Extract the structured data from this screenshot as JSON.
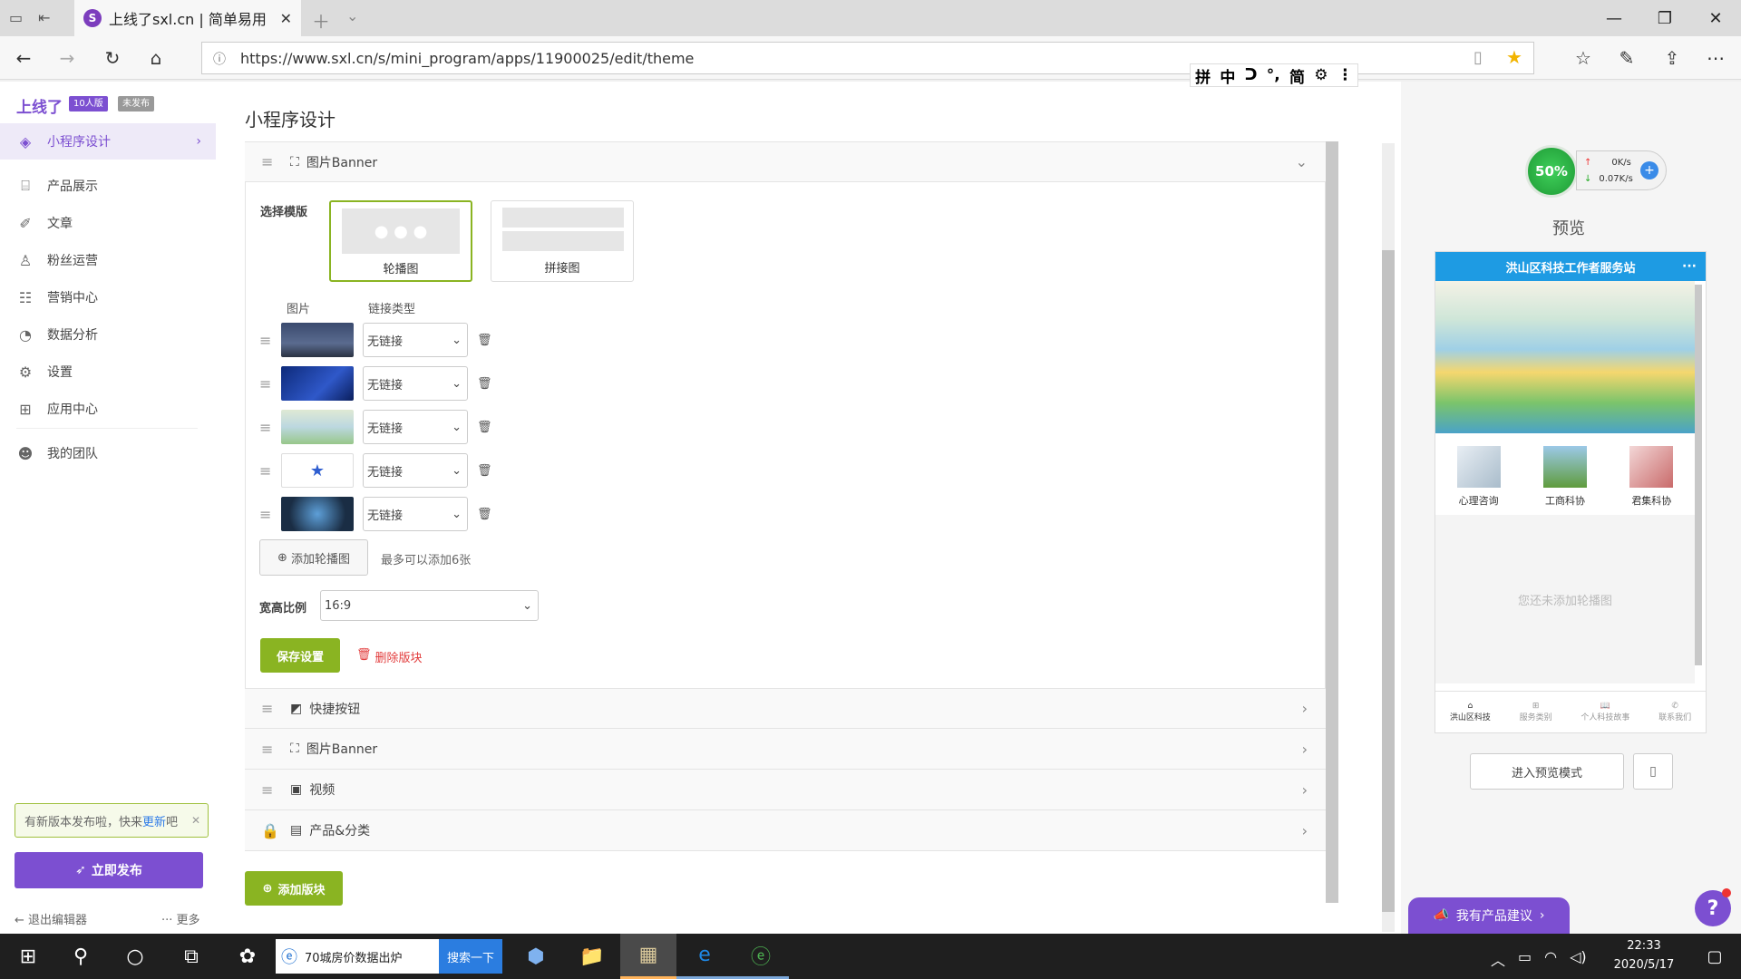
{
  "browser": {
    "tab_title": "上线了sxl.cn | 简单易用",
    "url": "https://www.sxl.cn/s/mini_program/apps/11900025/edit/theme",
    "ime": [
      "拼",
      "中",
      "ᑐ",
      "°,",
      "简",
      "⚙",
      "⋮"
    ]
  },
  "sidebar": {
    "logo": "上线了",
    "badge_plan": "10人版",
    "badge_status": "未发布",
    "items": [
      {
        "label": "小程序设计",
        "icon": "layers-icon"
      },
      {
        "label": "产品展示",
        "icon": "shop-icon"
      },
      {
        "label": "文章",
        "icon": "pen-icon"
      },
      {
        "label": "粉丝运营",
        "icon": "users-icon"
      },
      {
        "label": "营销中心",
        "icon": "ticket-icon"
      },
      {
        "label": "数据分析",
        "icon": "pie-icon"
      },
      {
        "label": "设置",
        "icon": "gear-icon"
      },
      {
        "label": "应用中心",
        "icon": "apps-icon"
      },
      {
        "label": "我的团队",
        "icon": "team-icon"
      }
    ],
    "update_text": "有新版本发布啦，快来",
    "update_link": "更新",
    "update_suffix": "吧",
    "publish_btn": "立即发布",
    "exit": "退出编辑器",
    "more": "··· 更多"
  },
  "main": {
    "title": "小程序设计",
    "banner_panel": {
      "name": "图片Banner",
      "template_label": "选择模版",
      "templates": [
        "轮播图",
        "拼接图"
      ],
      "col_image": "图片",
      "col_link": "链接类型",
      "rows": [
        {
          "link": "无链接"
        },
        {
          "link": "无链接"
        },
        {
          "link": "无链接"
        },
        {
          "link": "无链接"
        },
        {
          "link": "无链接"
        }
      ],
      "add_btn": "添加轮播图",
      "add_hint": "最多可以添加6张",
      "ratio_label": "宽高比例",
      "ratio_value": "16:9",
      "save_btn": "保存设置",
      "delete_btn": "删除版块"
    },
    "collapsed": [
      {
        "name": "快捷按钮"
      },
      {
        "name": "图片Banner"
      },
      {
        "name": "视频"
      },
      {
        "name": "产品&分类"
      }
    ],
    "add_block": "添加版块"
  },
  "preview": {
    "speed": {
      "percent": "50%",
      "up": "0K/s",
      "down": "0.07K/s"
    },
    "label": "预览",
    "phone_title": "洪山区科技工作者服务站",
    "quick": [
      {
        "label": "心理咨询"
      },
      {
        "label": "工商科协"
      },
      {
        "label": "君集科协"
      }
    ],
    "empty": "您还未添加轮播图",
    "tabs": [
      {
        "label": "洪山区科技"
      },
      {
        "label": "服务类别"
      },
      {
        "label": "个人科技故事"
      },
      {
        "label": "联系我们"
      }
    ],
    "enter_btn": "进入预览模式",
    "feedback": "我有产品建议"
  },
  "taskbar": {
    "search_text": "70城房价数据出炉",
    "search_btn": "搜索一下",
    "time": "22:33",
    "date": "2020/5/17"
  },
  "colors": {
    "accent": "#7c4fd1",
    "green": "#8ab422",
    "phone_header": "#1e9be3"
  }
}
